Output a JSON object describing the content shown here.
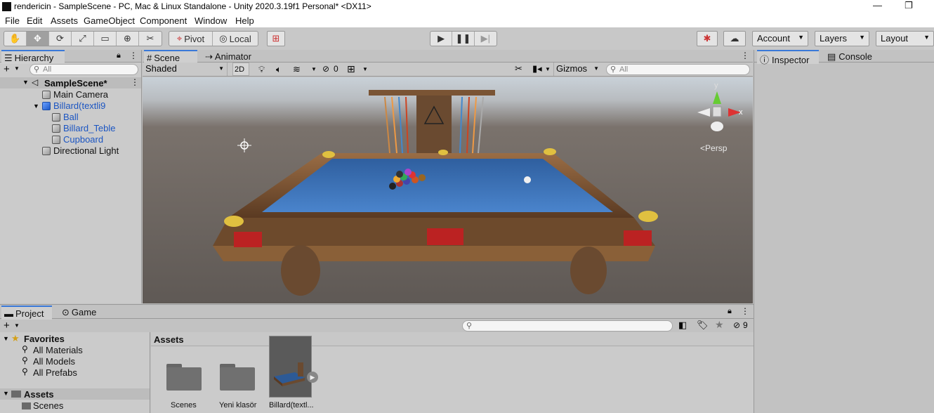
{
  "window": {
    "title": "rendericin - SampleScene - PC, Mac & Linux Standalone - Unity 2020.3.19f1 Personal* <DX11>"
  },
  "menu": [
    "File",
    "Edit",
    "Assets",
    "GameObject",
    "Component",
    "Window",
    "Help"
  ],
  "toolbar": {
    "pivot": "Pivot",
    "local": "Local",
    "account": "Account",
    "layers": "Layers",
    "layout": "Layout"
  },
  "hierarchy": {
    "tab": "Hierarchy",
    "search_placeholder": "All",
    "scene": "SampleScene*",
    "items": [
      "Main Camera",
      "Billard(textli9",
      "Ball",
      "Billard_Teble",
      "Cupboard",
      "Directional Light"
    ]
  },
  "scene": {
    "tabs": [
      "Scene",
      "Animator"
    ],
    "shading": "Shaded",
    "mode2d": "2D",
    "hidden_count": "0",
    "gizmos": "Gizmos",
    "search_placeholder": "All",
    "persp": "Persp",
    "axes": {
      "x": "x",
      "y": "y"
    }
  },
  "inspector": {
    "tabs": [
      "Inspector",
      "Console"
    ]
  },
  "project": {
    "tabs": [
      "Project",
      "Game"
    ],
    "hidden_count": "9",
    "favorites": "Favorites",
    "favorite_items": [
      "All Materials",
      "All Models",
      "All Prefabs"
    ],
    "assets_root": "Assets",
    "asset_folders": [
      "Scenes"
    ],
    "assets_header": "Assets",
    "assets": [
      "Scenes",
      "Yeni klasör",
      "Billard(textl..."
    ]
  },
  "colors": {
    "accent": "#3a79d8",
    "table_cloth": "#3a6fb8",
    "table_wood": "#7a5434"
  }
}
